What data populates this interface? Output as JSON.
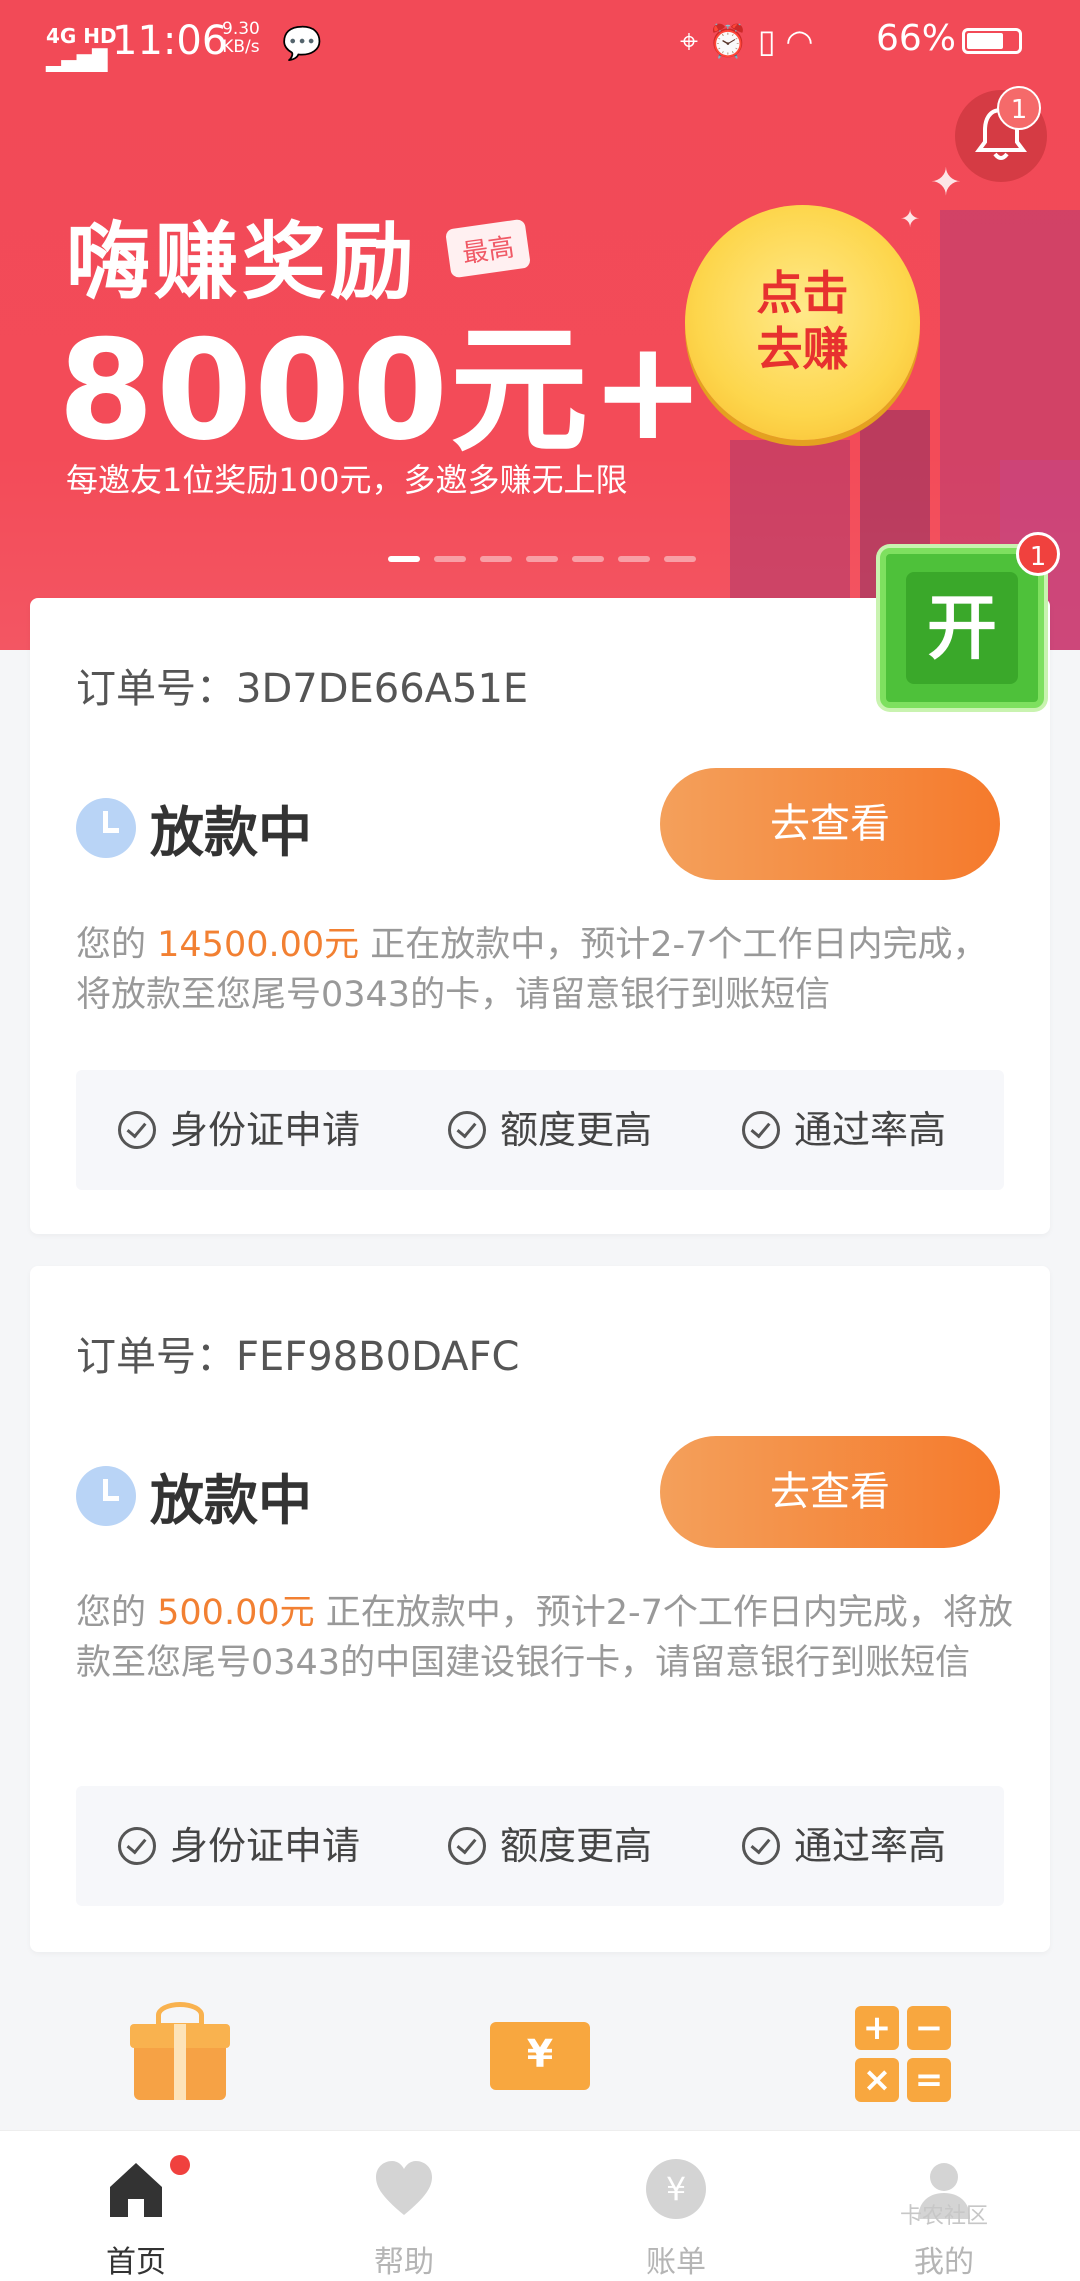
{
  "status_bar": {
    "network": "4G HD",
    "time": "11:06",
    "speed_value": "9.30",
    "speed_unit": "KB/s",
    "battery": "66%"
  },
  "banner": {
    "title": "嗨赚奖励",
    "tag": "最高",
    "amount": "8000元+",
    "subtitle": "每邀友1位奖励100元，多邀多赚无上限",
    "cta_line1": "点击",
    "cta_line2": "去赚",
    "notification_count": "1",
    "active_slide": 1,
    "slide_count": 7
  },
  "floating_button": {
    "label": "开",
    "badge": "1"
  },
  "orders": [
    {
      "order_no": "订单号：3D7DE66A51E",
      "status": "放款中",
      "button": "去查看",
      "desc_pre": "您的 ",
      "amount": "14500.00元",
      "desc_post": " 正在放款中，预计2-7个工作日内完成，将放款至您尾号0343的卡，请留意银行到账短信",
      "features": [
        "身份证申请",
        "额度更高",
        "通过率高"
      ]
    },
    {
      "order_no": "订单号：FEF98B0DAFC",
      "status": "放款中",
      "button": "去查看",
      "desc_pre": "您的 ",
      "amount": "500.00元",
      "desc_post": " 正在放款中，预计2-7个工作日内完成，将放款至您尾号0343的中国建设银行卡，请留意银行到账短信",
      "features": [
        "身份证申请",
        "额度更高",
        "通过率高"
      ]
    }
  ],
  "tools": {
    "ticket_symbol": "¥",
    "calc_symbols": [
      "+",
      "−",
      "×",
      "="
    ]
  },
  "tabbar": {
    "tabs": [
      {
        "label": "首页",
        "icon": "home-icon"
      },
      {
        "label": "帮助",
        "icon": "heart-icon"
      },
      {
        "label": "账单",
        "icon": "yen-icon"
      },
      {
        "label": "我的",
        "icon": "user-icon"
      }
    ]
  },
  "watermark": "卡农社区"
}
